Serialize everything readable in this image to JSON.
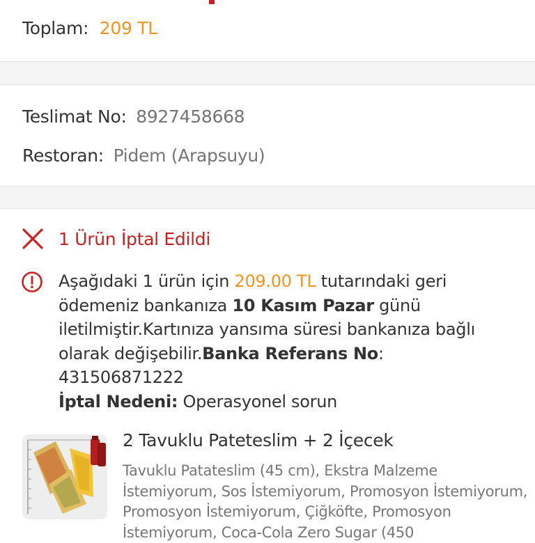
{
  "summary": {
    "total_label": "Toplam:",
    "total_value": "209 TL"
  },
  "delivery": {
    "delivery_no_label": "Teslimat No:",
    "delivery_no_value": "8927458668",
    "restaurant_label": "Restoran:",
    "restaurant_value": "Pidem (Arapsuyu)"
  },
  "cancellation": {
    "title": "1 Ürün İptal Edildi",
    "info_part1": "Aşağıdaki 1 ürün için ",
    "info_amount": "209.00 TL",
    "info_part2": " tutarındaki geri ödemeniz bankanıza ",
    "info_date": "10 Kasım Pazar",
    "info_part3": " günü iletilmiştir.Kartınıza yansıma süresi bankanıza bağlı olarak değişebilir.",
    "bank_ref_label": "Banka Referans No",
    "bank_ref_sep": ":",
    "bank_ref_value": "431506871222",
    "reason_label": "İptal Nedeni:",
    "reason_value": " Operasyonel sorun"
  },
  "product": {
    "name": "2 Tavuklu Pateteslim + 2 İçecek",
    "description": "Tavuklu Patateslim (45 cm), Ekstra Malzeme İstemiyorum, Sos İstemiyorum, Promosyon İstemiyorum, Promosyon İstemiyorum, Çiğköfte, Promosyon İstemiyorum, Coca-Cola Zero Sugar (450"
  },
  "colors": {
    "accent_orange": "#f6921e",
    "cancel_red": "#cc1f1f",
    "separator_band": "#f5f5f5"
  },
  "icons": {
    "cancel": "close-x-icon",
    "info": "info-circle-icon"
  }
}
